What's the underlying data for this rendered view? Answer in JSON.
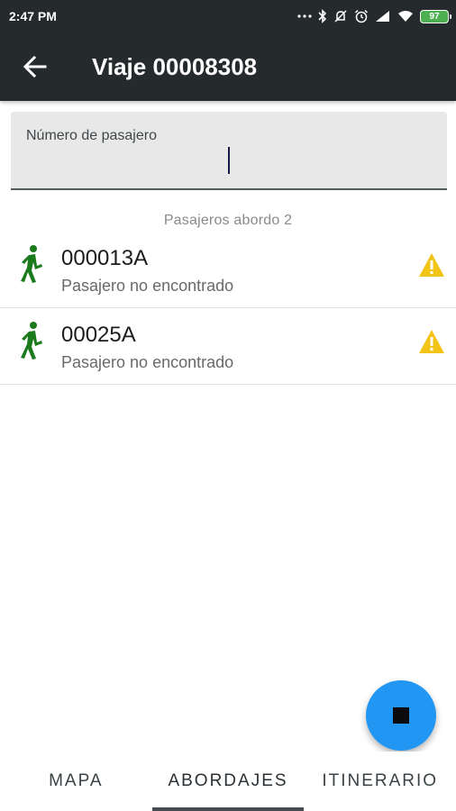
{
  "status_bar": {
    "time": "2:47 PM",
    "battery": "97",
    "icons": [
      "dots-icon",
      "bluetooth-icon",
      "mute-icon",
      "alarm-icon",
      "signal-icon",
      "wifi-icon",
      "battery-icon"
    ]
  },
  "app_bar": {
    "back_icon": "arrow-left-icon",
    "title": "Viaje 00008308"
  },
  "passenger_input": {
    "label": "Número de pasajero",
    "value": "",
    "placeholder": ""
  },
  "passengers": {
    "count_text": "Pasajeros abordo 2",
    "items": [
      {
        "id": "000013A",
        "status": "Pasajero no encontrado",
        "icon": "walking-person-icon",
        "alert_icon": "warning-icon"
      },
      {
        "id": "00025A",
        "status": "Pasajero no encontrado",
        "icon": "walking-person-icon",
        "alert_icon": "warning-icon"
      }
    ]
  },
  "fab": {
    "icon": "stop-icon"
  },
  "tabs": [
    {
      "label": "MAPA",
      "active": false
    },
    {
      "label": "ABORDAJES",
      "active": true
    },
    {
      "label": "ITINERARIO",
      "active": false
    }
  ],
  "colors": {
    "app_bar": "#252a2c",
    "fab": "#2196f3",
    "walking_icon": "#1b7a1b",
    "warning_icon": "#f2c416",
    "battery": "#4caf50"
  }
}
